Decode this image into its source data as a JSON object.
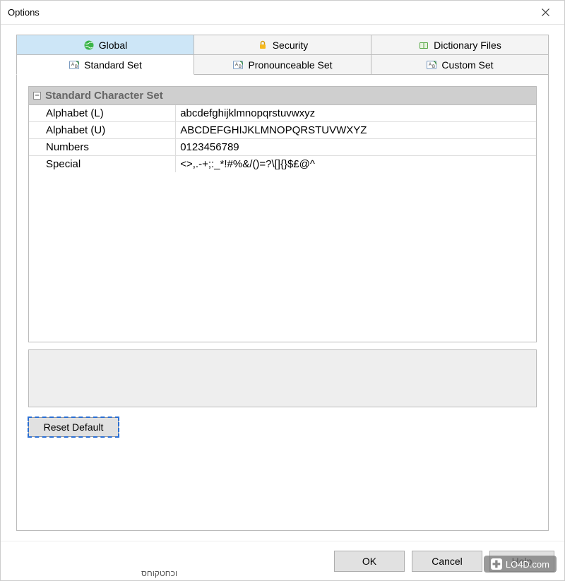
{
  "window": {
    "title": "Options"
  },
  "tabs": {
    "row1": [
      {
        "label": "Global",
        "icon": "globe-icon"
      },
      {
        "label": "Security",
        "icon": "lock-icon"
      },
      {
        "label": "Dictionary Files",
        "icon": "dictionary-icon"
      }
    ],
    "row2": [
      {
        "label": "Standard Set",
        "icon": "set-icon"
      },
      {
        "label": "Pronounceable Set",
        "icon": "set-icon"
      },
      {
        "label": "Custom Set",
        "icon": "set-icon"
      }
    ]
  },
  "group": {
    "title": "Standard Character Set",
    "rows": [
      {
        "key": "Alphabet (L)",
        "val": "abcdefghijklmnopqrstuvwxyz"
      },
      {
        "key": "Alphabet (U)",
        "val": "ABCDEFGHIJKLMNOPQRSTUVWXYZ"
      },
      {
        "key": "Numbers",
        "val": "0123456789"
      },
      {
        "key": "Special",
        "val": "<>,.-+;:_*!#%&/()=?\\[]{}$£@^"
      }
    ]
  },
  "buttons": {
    "reset": "Reset Default",
    "ok": "OK",
    "cancel": "Cancel",
    "help": "Help"
  },
  "watermark": "LO4D.com",
  "background_text": "וכחטקוחס"
}
